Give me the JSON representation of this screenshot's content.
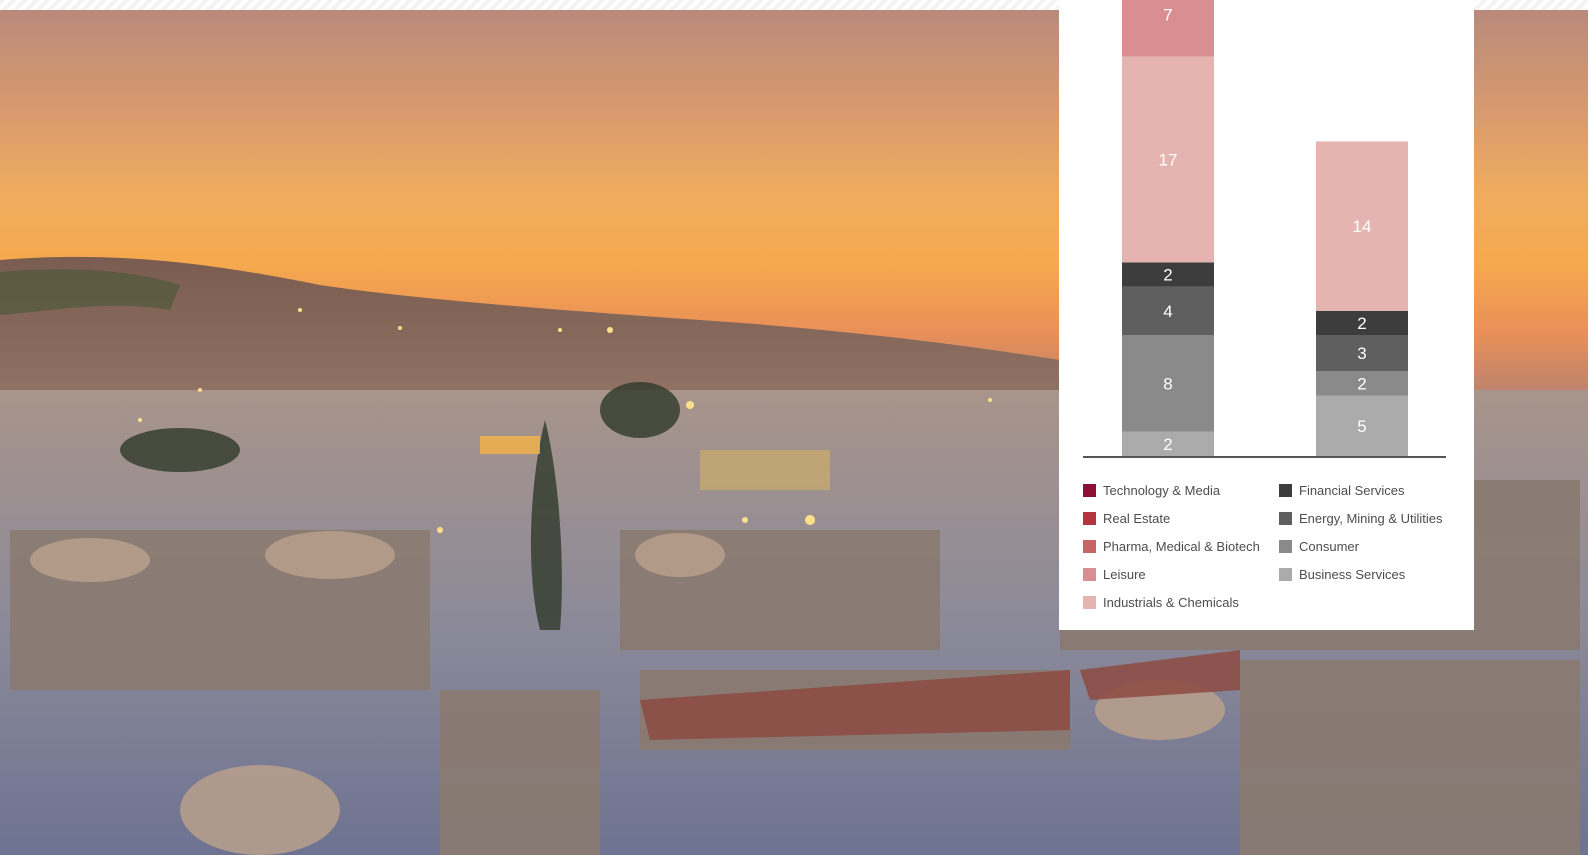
{
  "chart_data": {
    "type": "bar",
    "stacked": true,
    "categories": [
      "",
      ""
    ],
    "series": [
      {
        "name": "Technology & Media",
        "color": "#8e0f36",
        "values": [
          null,
          null
        ]
      },
      {
        "name": "Real Estate",
        "color": "#b3363f",
        "values": [
          null,
          null
        ]
      },
      {
        "name": "Pharma, Medical & Biotech",
        "color": "#c96464",
        "values": [
          null,
          null
        ]
      },
      {
        "name": "Leisure",
        "color": "#d98f92",
        "values": [
          7,
          null
        ]
      },
      {
        "name": "Industrials & Chemicals",
        "color": "#e5b4b1",
        "values": [
          17,
          14
        ]
      },
      {
        "name": "Financial Services",
        "color": "#3d3d3d",
        "values": [
          2,
          2
        ]
      },
      {
        "name": "Energy, Mining & Utilities",
        "color": "#5f5f5f",
        "values": [
          4,
          3
        ]
      },
      {
        "name": "Consumer",
        "color": "#8a8a8a",
        "values": [
          8,
          2
        ]
      },
      {
        "name": "Business Services",
        "color": "#ababab",
        "values": [
          2,
          5
        ]
      }
    ],
    "legend_position": "bottom",
    "grid": false
  }
}
